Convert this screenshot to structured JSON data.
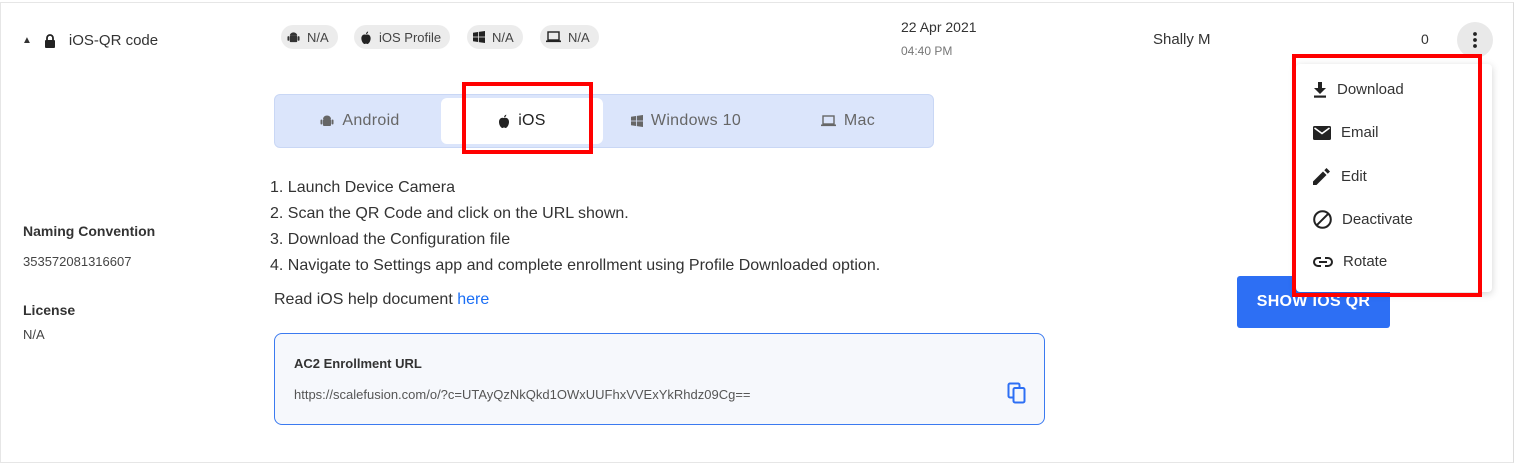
{
  "row": {
    "name": "iOS-QR code",
    "chips": {
      "android": "N/A",
      "ios": "iOS Profile",
      "windows": "N/A",
      "mac": "N/A"
    },
    "date": "22 Apr 2021",
    "time": "04:40 PM",
    "owner": "Shally M",
    "count": "0"
  },
  "tabs": {
    "android": "Android",
    "ios": "iOS",
    "windows": "Windows 10",
    "mac": "Mac",
    "active": "ios"
  },
  "steps": [
    "1. Launch Device Camera",
    "2. Scan the QR Code and click on the URL shown.",
    "3. Download the Configuration file",
    "4. Navigate to Settings app and complete enrollment using Profile Downloaded option."
  ],
  "help": {
    "text": "Read iOS help document ",
    "link": "here"
  },
  "details": {
    "naming_label": "Naming Convention",
    "naming_value": "353572081316607",
    "license_label": "License",
    "license_value": "N/A"
  },
  "enrollment": {
    "title": "AC2 Enrollment URL",
    "url": "https://scalefusion.com/o/?c=UTAyQzNkQkd1OWxUUFhxVVExYkRhdz09Cg=="
  },
  "show_button": "SHOW IOS QR",
  "menu": {
    "download": "Download",
    "email": "Email",
    "edit": "Edit",
    "deactivate": "Deactivate",
    "rotate": "Rotate"
  },
  "colors": {
    "accent": "#2d6ff4",
    "highlight": "#ff0000",
    "tab_bg": "#dbe5fb"
  }
}
